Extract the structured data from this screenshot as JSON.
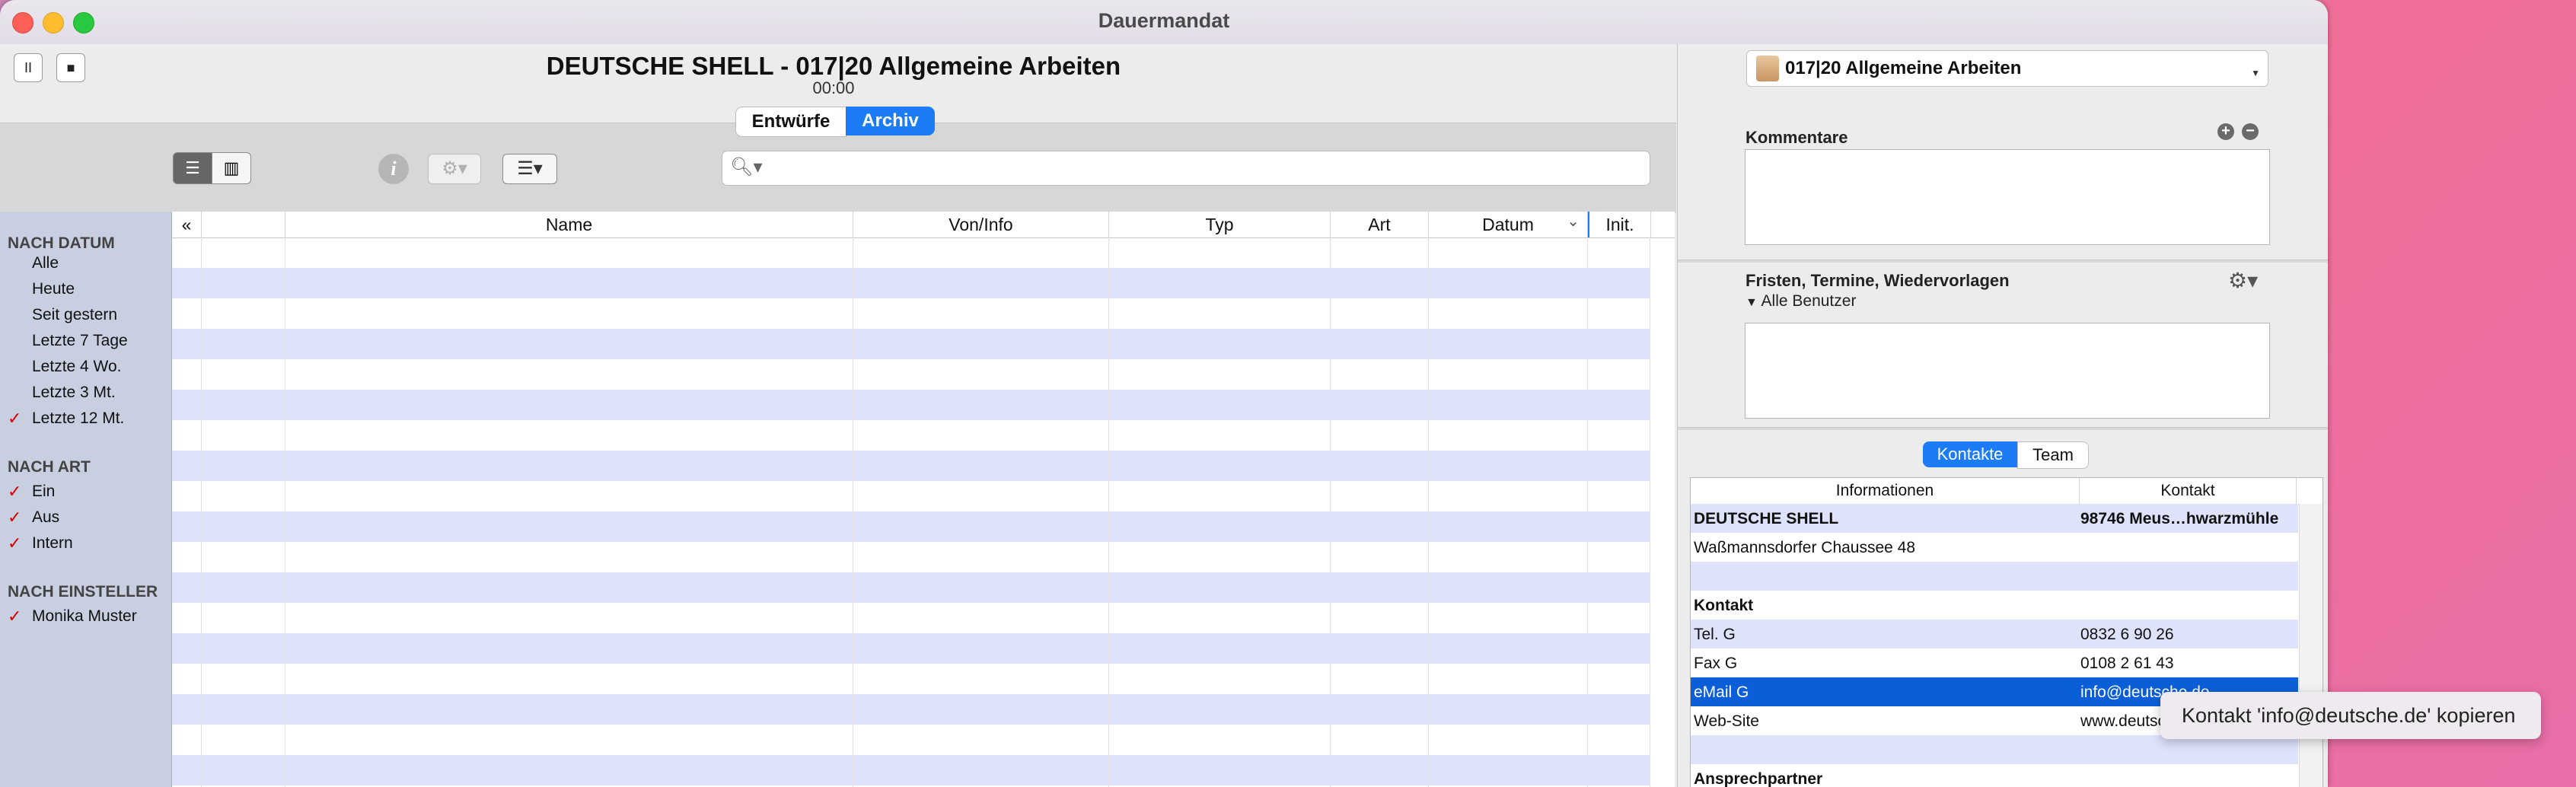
{
  "window": {
    "title": "Dauermandat"
  },
  "header": {
    "pause_symbol": "II",
    "stop_symbol": "■",
    "doc_title": "DEUTSCHE SHELL - 017|20 Allgemeine Arbeiten",
    "timer": "00:00",
    "segments": [
      "Entwürfe",
      "Archiv"
    ],
    "active_segment": "Archiv"
  },
  "toolbar": {
    "search_placeholder": ""
  },
  "sidebar": {
    "groups": [
      {
        "heading": "NACH DATUM",
        "items": [
          {
            "label": "Alle",
            "checked": false
          },
          {
            "label": "Heute",
            "checked": false
          },
          {
            "label": "Seit gestern",
            "checked": false
          },
          {
            "label": "Letzte 7 Tage",
            "checked": false
          },
          {
            "label": "Letzte 4 Wo.",
            "checked": false
          },
          {
            "label": "Letzte 3 Mt.",
            "checked": false
          },
          {
            "label": "Letzte 12 Mt.",
            "checked": true
          }
        ]
      },
      {
        "heading": "NACH ART",
        "items": [
          {
            "label": "Ein",
            "checked": true
          },
          {
            "label": "Aus",
            "checked": true
          },
          {
            "label": "Intern",
            "checked": true
          }
        ]
      },
      {
        "heading": "NACH EINSTELLER",
        "items": [
          {
            "label": "Monika Muster",
            "checked": true
          }
        ]
      }
    ],
    "check_symbol": "✓"
  },
  "table": {
    "columns": [
      "«",
      "",
      "Name",
      "Von/Info",
      "Typ",
      "Art",
      "Datum",
      "Init."
    ],
    "sort_indicator": "⌄"
  },
  "right": {
    "mandate": "017|20 Allgemeine Arbeiten",
    "comments_label": "Kommentare",
    "deadlines_label": "Fristen, Termine, Wiedervorlagen",
    "users_label": "Alle Benutzer",
    "tabs": [
      "Kontakte",
      "Team"
    ],
    "contacts_columns": [
      "Informationen",
      "Kontakt"
    ],
    "contacts_rows": [
      {
        "info": "DEUTSCHE SHELL",
        "contact": "98746 Meus…hwarzmühle",
        "bold": true,
        "style": "alt"
      },
      {
        "info": "Waßmannsdorfer Chaussee 48",
        "contact": "",
        "bold": false,
        "style": ""
      },
      {
        "info": "",
        "contact": "",
        "bold": false,
        "style": "alt"
      },
      {
        "info": "Kontakt",
        "contact": "",
        "bold": true,
        "style": ""
      },
      {
        "info": "Tel. G",
        "contact": "0832 6 90 26",
        "bold": false,
        "style": "alt"
      },
      {
        "info": "Fax G",
        "contact": "0108 2 61 43",
        "bold": false,
        "style": ""
      },
      {
        "info": "eMail G",
        "contact": "info@deutsche.de",
        "bold": false,
        "style": "sel"
      },
      {
        "info": "Web-Site",
        "contact": "www.deutsche.de",
        "bold": false,
        "style": ""
      },
      {
        "info": "",
        "contact": "",
        "bold": false,
        "style": "alt"
      },
      {
        "info": "Ansprechpartner",
        "contact": "",
        "bold": true,
        "style": ""
      }
    ]
  },
  "context_menu": {
    "label": "Kontakt 'info@deutsche.de' kopieren"
  }
}
